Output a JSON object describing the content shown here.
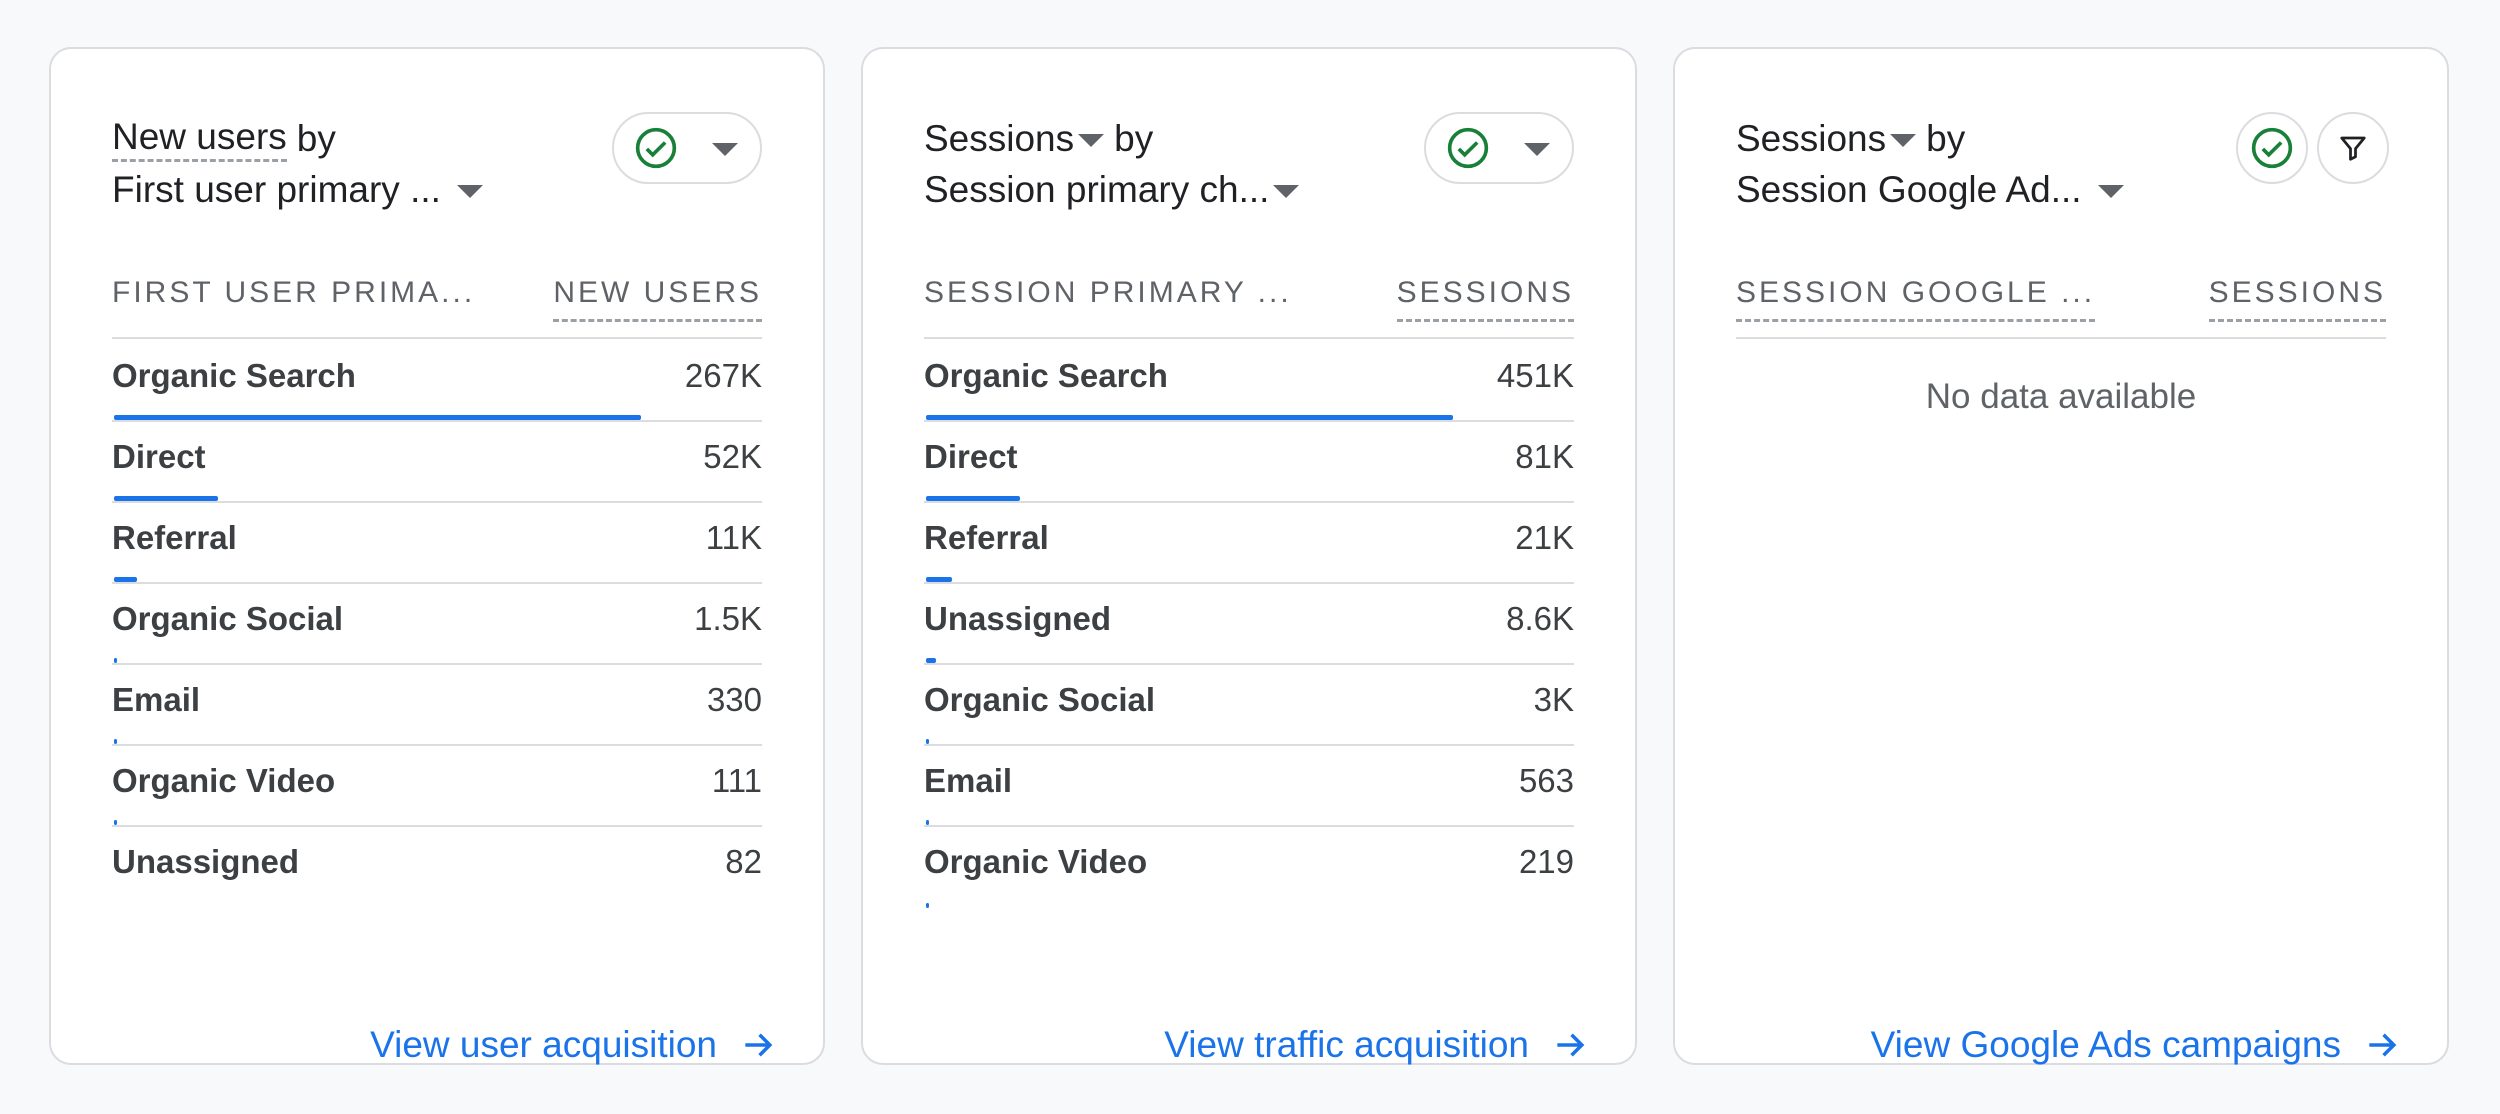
{
  "cards": [
    {
      "metric": "New users",
      "by": "by",
      "dimension": "First user primary ...",
      "col_dim": "FIRST USER PRIMA...",
      "col_metric": "NEW USERS",
      "rows": [
        {
          "label": "Organic Search",
          "value": "267K",
          "share": 0.81
        },
        {
          "label": "Direct",
          "value": "52K",
          "share": 0.16
        },
        {
          "label": "Referral",
          "value": "11K",
          "share": 0.035
        },
        {
          "label": "Organic Social",
          "value": "1.5K",
          "share": 0.005
        },
        {
          "label": "Email",
          "value": "330",
          "share": 0.003
        },
        {
          "label": "Organic Video",
          "value": "111",
          "share": 0.003
        },
        {
          "label": "Unassigned",
          "value": "82",
          "share": 0
        }
      ],
      "link": "View user acquisition"
    },
    {
      "metric": "Sessions",
      "by": "by",
      "dimension": "Session primary ch...",
      "col_dim": "SESSION PRIMARY ...",
      "col_metric": "SESSIONS",
      "rows": [
        {
          "label": "Organic Search",
          "value": "451K",
          "share": 0.81
        },
        {
          "label": "Direct",
          "value": "81K",
          "share": 0.145
        },
        {
          "label": "Referral",
          "value": "21K",
          "share": 0.04
        },
        {
          "label": "Unassigned",
          "value": "8.6K",
          "share": 0.015
        },
        {
          "label": "Organic Social",
          "value": "3K",
          "share": 0.005
        },
        {
          "label": "Email",
          "value": "563",
          "share": 0.003
        },
        {
          "label": "Organic Video",
          "value": "219",
          "share": 0.003
        }
      ],
      "link": "View traffic acquisition"
    },
    {
      "metric": "Sessions",
      "by": "by",
      "dimension": "Session Google Ad...",
      "col_dim": "SESSION GOOGLE ...",
      "col_metric": "SESSIONS",
      "empty_text": "No data available",
      "link": "View Google Ads campaigns"
    }
  ],
  "icons": {
    "check": "check-circle-icon",
    "dropdown": "triangle-down-icon",
    "filter": "filter-icon",
    "arrow": "arrow-right-icon"
  },
  "colors": {
    "accent": "#1a73e8",
    "check": "#188038",
    "border": "#dadce0"
  }
}
